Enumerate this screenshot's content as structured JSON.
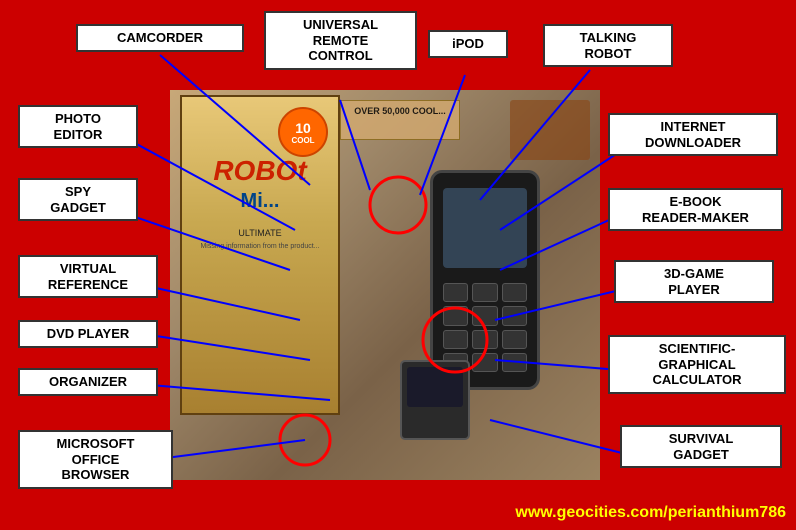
{
  "labels": {
    "camcorder": "CAMCORDER",
    "universal_remote": "UNIVERSAL\nREMOTE\nCONTROL",
    "ipod": "iPOD",
    "talking_robot": "TALKING\nROBOT",
    "photo_editor": "PHOTO\nEDITOR",
    "internet_downloader": "INTERNET\nDOWNLOADER",
    "spy_gadget": "SPY\nGADGET",
    "ebook_reader": "E-BOOK\nREADER-MAKER",
    "virtual_reference": "VIRTUAL\nREFERENCE",
    "game_player": "3D-GAME\nPLAYER",
    "dvd_player": "DVD PLAYER",
    "scientific_calc": "SCIENTIFIC-\nGRAPHICAL\nCALCULATOR",
    "organizer": "ORGANIZER",
    "survival_gadget": "SURVIVAL\nGADGET",
    "microsoft_office": "MICROSOFT\nOFFICE\nBROWSER",
    "website": "www.geocities.com/perianthium786"
  },
  "colors": {
    "background": "#cc0000",
    "label_bg": "#ffffff",
    "label_border": "#333333",
    "line_color": "#0000ff",
    "text_color": "#000000",
    "website_color": "#ffff00"
  }
}
